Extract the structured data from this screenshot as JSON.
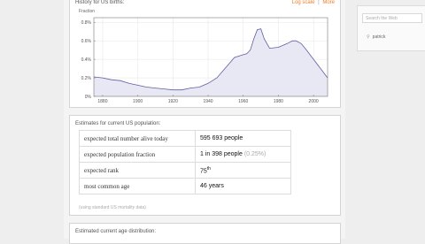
{
  "history": {
    "title": "History for US births:",
    "log_scale_link": "Log scale",
    "separator": "|",
    "more_link": "More",
    "y_axis_label": "Fraction"
  },
  "chart_data": {
    "type": "area",
    "title": "History for US births:",
    "ylabel": "Fraction",
    "xlabel": "",
    "xlim": [
      1875,
      2008
    ],
    "ylim": [
      0,
      0.85
    ],
    "ytick_labels": [
      "0%",
      "0.2%",
      "0.4%",
      "0.6%",
      "0.8%"
    ],
    "ytick_values": [
      0,
      0.2,
      0.4,
      0.6,
      0.8
    ],
    "xtick_labels": [
      "1880",
      "1900",
      "1920",
      "1940",
      "1960",
      "1980",
      "2000"
    ],
    "xtick_values": [
      1880,
      1900,
      1920,
      1940,
      1960,
      1980,
      2000
    ],
    "x": [
      1875,
      1880,
      1885,
      1890,
      1895,
      1900,
      1905,
      1910,
      1915,
      1920,
      1925,
      1930,
      1935,
      1940,
      1945,
      1950,
      1955,
      1960,
      1962,
      1964,
      1966,
      1968,
      1970,
      1972,
      1975,
      1980,
      1985,
      1988,
      1990,
      1993,
      1996,
      2000,
      2004,
      2008
    ],
    "y": [
      0.21,
      0.2,
      0.18,
      0.17,
      0.14,
      0.12,
      0.1,
      0.09,
      0.08,
      0.07,
      0.07,
      0.09,
      0.1,
      0.14,
      0.2,
      0.31,
      0.42,
      0.45,
      0.46,
      0.5,
      0.62,
      0.72,
      0.73,
      0.62,
      0.52,
      0.53,
      0.57,
      0.6,
      0.6,
      0.57,
      0.5,
      0.4,
      0.3,
      0.2
    ],
    "grid": true,
    "fill_color": "#e8e8f4",
    "line_color": "#5e5ea0"
  },
  "estimates": {
    "title": "Estimates for current US population:",
    "rows": [
      {
        "label": "expected total number alive today",
        "value": "595 693 people"
      },
      {
        "label": "expected population fraction",
        "value": "1 in 398 people",
        "extra": "(0.25%)"
      },
      {
        "label": "expected rank",
        "value": "75",
        "sup": "th"
      },
      {
        "label": "most common age",
        "value": "46 years"
      }
    ],
    "note": "(using standard US mortality data)"
  },
  "distribution": {
    "title": "Estimated current age distribution:"
  },
  "sidebar": {
    "search_placeholder": "Search the Web",
    "result_label": "patrick"
  }
}
